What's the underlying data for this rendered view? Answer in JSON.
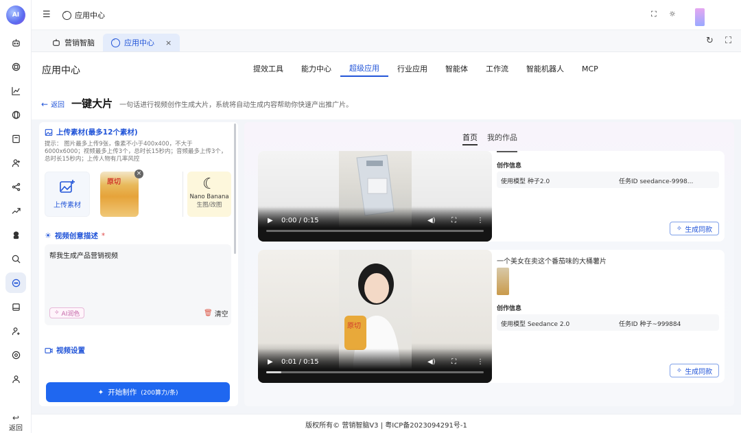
{
  "app": {
    "logo_text": "AI",
    "title": "应用中心",
    "back_label": "返回"
  },
  "rail_icons": [
    "robot-icon",
    "chip-icon",
    "chart-icon",
    "globe-icon",
    "book-icon",
    "user-add-icon",
    "share-icon",
    "trend-icon",
    "bot-icon",
    "search-globe-icon",
    "app-center-icon",
    "calendar-icon",
    "user-plus-icon",
    "target-icon",
    "user-icon"
  ],
  "tabs": [
    {
      "label": "营销智脑",
      "active": false
    },
    {
      "label": "应用中心",
      "active": true,
      "close": "×"
    }
  ],
  "header": {
    "page_title": "应用中心",
    "nav": [
      "提效工具",
      "能力中心",
      "超级应用",
      "行业应用",
      "智能体",
      "工作流",
      "智能机器人",
      "MCP"
    ],
    "nav_active": "超级应用",
    "back": "返回",
    "title": "一键大片",
    "subtitle": "一句话进行视频创作生成大片，系统将自动生成内容帮助你快速产出推广片。"
  },
  "left": {
    "upload_title": "上传素材(最多12个素材)",
    "hint": "提示： 图片最多上传9张，像素不小于400x400，不大于6000x6000；视频最多上传3个，总时长15秒内；音频最多上传3个，总时长15秒内；上传人物有几率风控",
    "upload_label": "上传素材",
    "thumb_brand": "原切",
    "thumb_close": "×",
    "nano_line1": "Nano Banana",
    "nano_line2": "生图/改图",
    "desc_title": "视频创意描述",
    "desc_required": "*",
    "desc_value": "帮我生成产品营销视频",
    "ai_polish": "AI润色",
    "clear": "清空",
    "settings_title": "视频设置",
    "start_label": "开始制作",
    "start_cost": "(200算力/条)"
  },
  "right": {
    "tabs": [
      "首页",
      "我的作品"
    ],
    "tab_active": "首页",
    "cards": [
      {
        "prompt": "",
        "time": "0:00 / 0:15",
        "progress": 0.0,
        "info_label": "创作信息",
        "model": "使用模型 种子2.0",
        "task": "任务ID seedance-9998...",
        "gen": "生成同款"
      },
      {
        "prompt": "一个美女在卖这个番茄味的大桶薯片",
        "time": "0:01 / 0:15",
        "progress": 0.07,
        "info_label": "创作信息",
        "model": "使用模型 Seedance 2.0",
        "task": "任务ID 种子~999884",
        "gen": "生成同款"
      }
    ]
  },
  "footer": "版权所有© 营销智脑V3 | 粤ICP备2023094291号-1",
  "colors": {
    "accent": "#2255d8",
    "button": "#1f67f0"
  }
}
